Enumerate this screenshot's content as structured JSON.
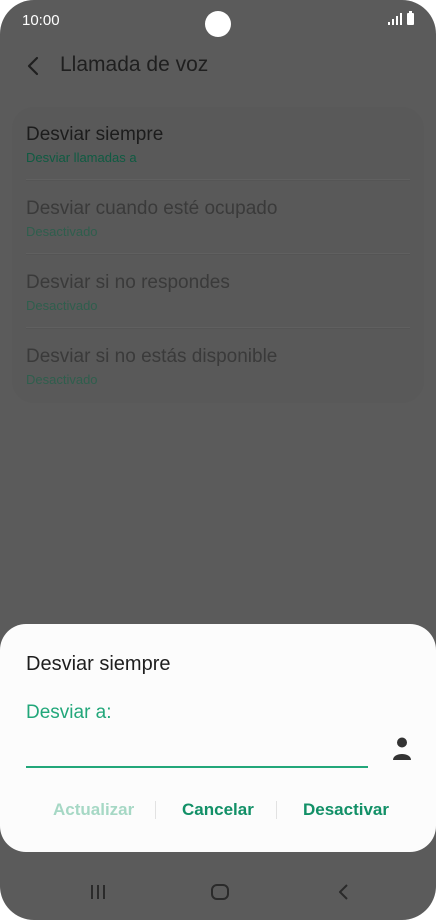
{
  "status_bar": {
    "time": "10:00"
  },
  "app_bar": {
    "title": "Llamada de voz",
    "back_icon": "chevron-left-icon"
  },
  "forward_options": [
    {
      "label": "Desviar siempre",
      "sub": "Desviar llamadas a",
      "enabled": true
    },
    {
      "label": "Desviar cuando esté ocupado",
      "sub": "Desactivado",
      "enabled": false
    },
    {
      "label": "Desviar si no respondes",
      "sub": "Desactivado",
      "enabled": false
    },
    {
      "label": "Desviar si no estás disponible",
      "sub": "Desactivado",
      "enabled": false
    }
  ],
  "dialog": {
    "title": "Desviar siempre",
    "field_label": "Desviar a:",
    "field_value": "",
    "contact_icon": "person-icon",
    "actions": {
      "update": "Actualizar",
      "cancel": "Cancelar",
      "deactivate": "Desactivar"
    }
  },
  "nav_bar": {
    "recents_icon": "recents-icon",
    "home_icon": "home-icon",
    "back_icon": "back-icon"
  },
  "colors": {
    "accent": "#22a77a",
    "dim_overlay": "#5b5b5b",
    "sheet": "#fcfcfc"
  }
}
